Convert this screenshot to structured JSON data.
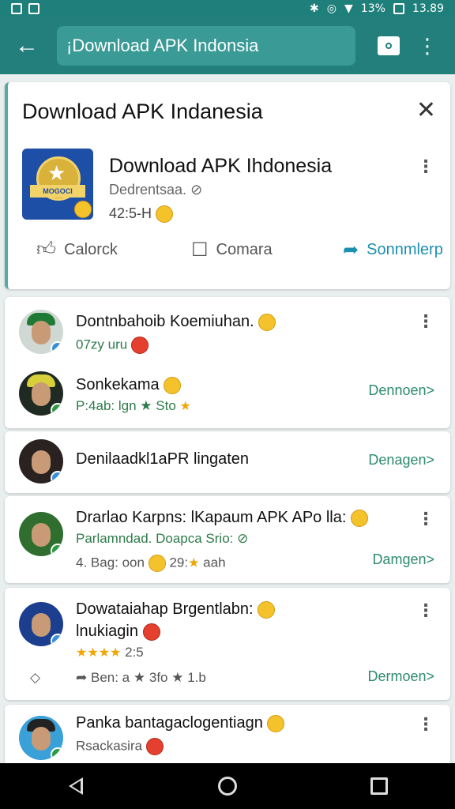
{
  "status": {
    "time": "13.89",
    "battery": "13%"
  },
  "search": {
    "value": "¡Download APK Indonsia"
  },
  "app_card": {
    "title": "Download APK Indanesia",
    "app_name": "Download APK Ihdonesia",
    "developer": "Dedrentsaa.",
    "rating": "42:5-H",
    "icon_ribbon": "MOGOCI",
    "actions": {
      "like": "Calorck",
      "comment": "Comara",
      "share": "Sonnmlerp"
    }
  },
  "items": [
    {
      "name": "Dontnbahoib Koemiuhan.",
      "meta": "07zy uru",
      "download": ""
    },
    {
      "name": "Sonkekama",
      "meta": "P:4ab: lgn",
      "meta2": "Sto",
      "download": "Dennoen>"
    },
    {
      "name": "Denilaadkl1aPR lingaten",
      "meta": "",
      "download": "Denagen>"
    },
    {
      "name": "Drarlao Karpns: lKapaum APK APo lla:",
      "meta": "Parlamndad. Doapca Srio:",
      "meta2": "4. Bag: oon",
      "meta3": "29:",
      "meta4": "aah",
      "download": "Damgen>"
    },
    {
      "name": "Dowataiahap Brgentlabn:",
      "meta": "lnukiagin",
      "meta2": "2:5",
      "meta3": "Ben: a",
      "meta4": "3fo",
      "meta5": "1.b",
      "download": "Dermoen>"
    },
    {
      "name": "Panka bantagaclogentiagn",
      "meta": "Rsackasira",
      "download": ""
    }
  ],
  "colors": {
    "appbar": "#237f7b",
    "accent": "#2d8a6d",
    "share": "#1d8fb0"
  }
}
